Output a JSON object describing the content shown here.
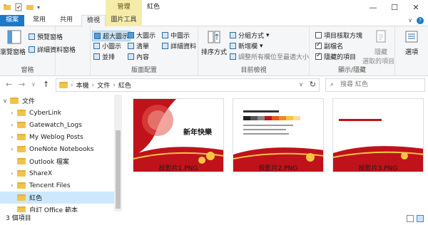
{
  "window": {
    "title": "紅色",
    "context_tab_header": "管理"
  },
  "tabs": [
    {
      "label": "檔案"
    },
    {
      "label": "常用"
    },
    {
      "label": "共用"
    },
    {
      "label": "檢視"
    },
    {
      "label": "圖片工具"
    }
  ],
  "ribbon": {
    "panes": {
      "label": "窗格",
      "nav_pane": "瀏覽窗格",
      "preview_pane": "預覽窗格",
      "details_pane": "詳細資料窗格"
    },
    "layout": {
      "label": "版面配置",
      "options": [
        "超大圖示",
        "大圖示",
        "中圖示",
        "小圖示",
        "清單",
        "詳細資料",
        "並排",
        "內容"
      ],
      "selected": "超大圖示"
    },
    "current_view": {
      "label": "目前檢視",
      "sort": "排序方式",
      "group_by": "分組方式",
      "add_columns": "新增欄",
      "size_columns": "調整所有欄位至最適大小"
    },
    "show_hide": {
      "label": "顯示/隱藏",
      "item_checkboxes": "項目核取方塊",
      "file_extensions": "副檔名",
      "hidden_items": "隱藏的項目",
      "hide_selected": "隱藏",
      "hide_selected_2": "選取的項目",
      "checkbox_states": {
        "item_checkboxes": false,
        "file_extensions": true,
        "hidden_items": true
      }
    },
    "options": "選項"
  },
  "address": {
    "path": [
      "本機",
      "文件",
      "紅色"
    ],
    "search_placeholder": "搜尋 紅色"
  },
  "nav_tree": [
    {
      "label": "文件",
      "expanded": true,
      "level": 0
    },
    {
      "label": "CyberLink",
      "level": 1
    },
    {
      "label": "Gatewatch_Logs",
      "level": 1
    },
    {
      "label": "My Weblog Posts",
      "level": 1
    },
    {
      "label": "OneNote Notebooks",
      "level": 1
    },
    {
      "label": "Outlook 檔案",
      "level": 1
    },
    {
      "label": "ShareX",
      "level": 1
    },
    {
      "label": "Tencent Files",
      "level": 1
    },
    {
      "label": "紅色",
      "level": 1,
      "selected": true
    },
    {
      "label": "自訂 Office 範本",
      "level": 1
    }
  ],
  "files": [
    {
      "name": "投影片1.PNG",
      "slide_title": "新年快樂"
    },
    {
      "name": "投影片2.PNG",
      "slide_title": ""
    },
    {
      "name": "投影片3.PNG",
      "slide_title": ""
    }
  ],
  "status": {
    "item_count": "3 個項目"
  },
  "colors": {
    "accent": "#1979ca",
    "context_tab": "#f5ecab",
    "selection": "#cce8ff",
    "folder": "#f0c44c",
    "slide_red": "#c0121b"
  }
}
